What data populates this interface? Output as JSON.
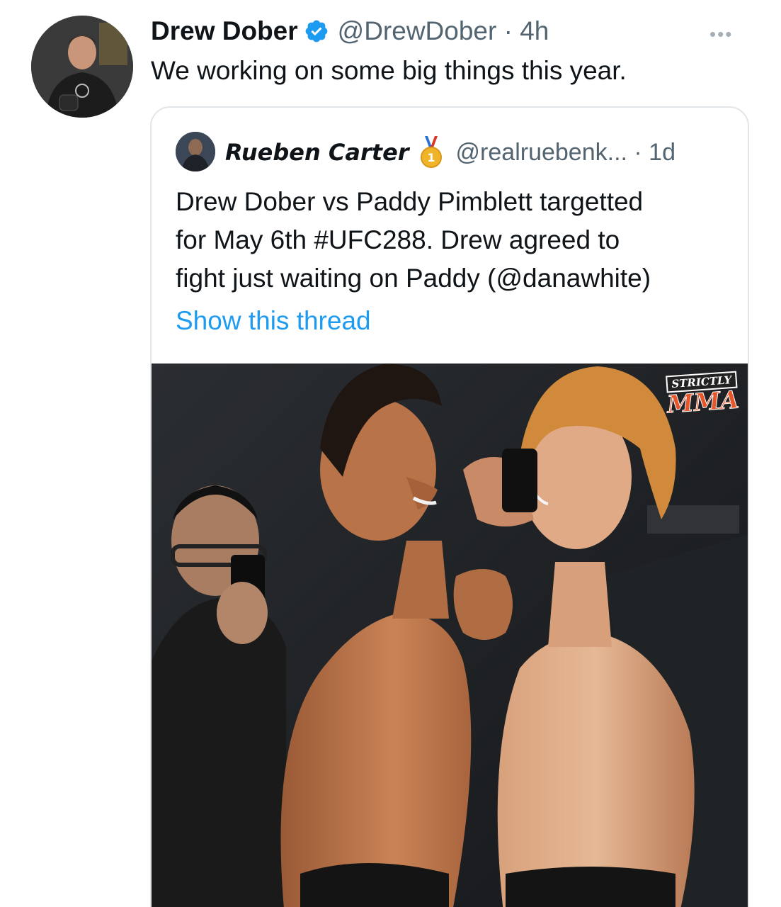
{
  "tweet": {
    "author": {
      "display_name": "Drew Dober",
      "handle_meta": "@DrewDober · 4h",
      "verified_icon": "verified-badge-icon"
    },
    "more_label": "•••",
    "text": "We working on some big things this year."
  },
  "quoted_tweet": {
    "author": {
      "display_name": "Rueben Carter",
      "badge_icon": "gold-medal-icon",
      "handle_meta": "@realruebenk... · 1d"
    },
    "text_lines": [
      "Drew Dober vs Paddy Pimblett targetted",
      "for May 6th #UFC288. Drew agreed to",
      "fight just waiting on Paddy (@danawhite)"
    ],
    "show_thread": "Show this thread",
    "media": {
      "watermark_top": "STRICTLY",
      "watermark_bottom": "MMA"
    }
  },
  "colors": {
    "link": "#1d9bf0",
    "verified": "#1d9bf0",
    "secondary_text": "#536471",
    "border": "#e3e6e8"
  }
}
